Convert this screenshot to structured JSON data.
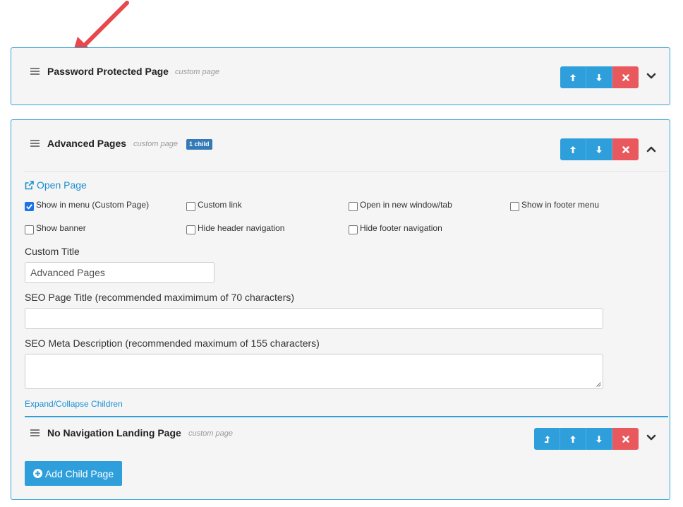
{
  "annotation": {
    "arrow_color": "#e8474c"
  },
  "colors": {
    "accent": "#2f9fdc",
    "delete": "#e9585c",
    "badge": "#337ab7",
    "link": "#1a8fd1"
  },
  "items": [
    {
      "title": "Password Protected Page",
      "type": "custom page",
      "buttons": [
        "arrow-up-icon",
        "arrow-down-icon",
        "close-icon"
      ],
      "expanded": false
    },
    {
      "title": "Advanced Pages",
      "type": "custom page",
      "badge": "1 child",
      "buttons": [
        "arrow-up-icon",
        "arrow-down-icon",
        "close-icon"
      ],
      "expanded": true,
      "open_link": "Open Page",
      "checkboxes": [
        {
          "label": "Show in menu (Custom Page)",
          "checked": true
        },
        {
          "label": "Custom link",
          "checked": false
        },
        {
          "label": "Open in new window/tab",
          "checked": false
        },
        {
          "label": "Show in footer menu",
          "checked": false
        },
        {
          "label": "Show banner",
          "checked": false
        },
        {
          "label": "Hide header navigation",
          "checked": false
        },
        {
          "label": "Hide footer navigation",
          "checked": false
        }
      ],
      "custom_title_label": "Custom Title",
      "custom_title_value": "Advanced Pages",
      "seo_title_label": "SEO Page Title (recommended maximimum of 70 characters)",
      "seo_title_value": "",
      "seo_desc_label": "SEO Meta Description (recommended maximum of 155 characters)",
      "seo_desc_value": "",
      "expand_collapse_label": "Expand/Collapse Children",
      "children": [
        {
          "title": "No Navigation Landing Page",
          "type": "custom page",
          "buttons": [
            "outdent-icon",
            "arrow-up-icon",
            "arrow-down-icon",
            "close-icon"
          ],
          "expanded": false
        }
      ],
      "add_child_label": "Add Child Page"
    }
  ]
}
